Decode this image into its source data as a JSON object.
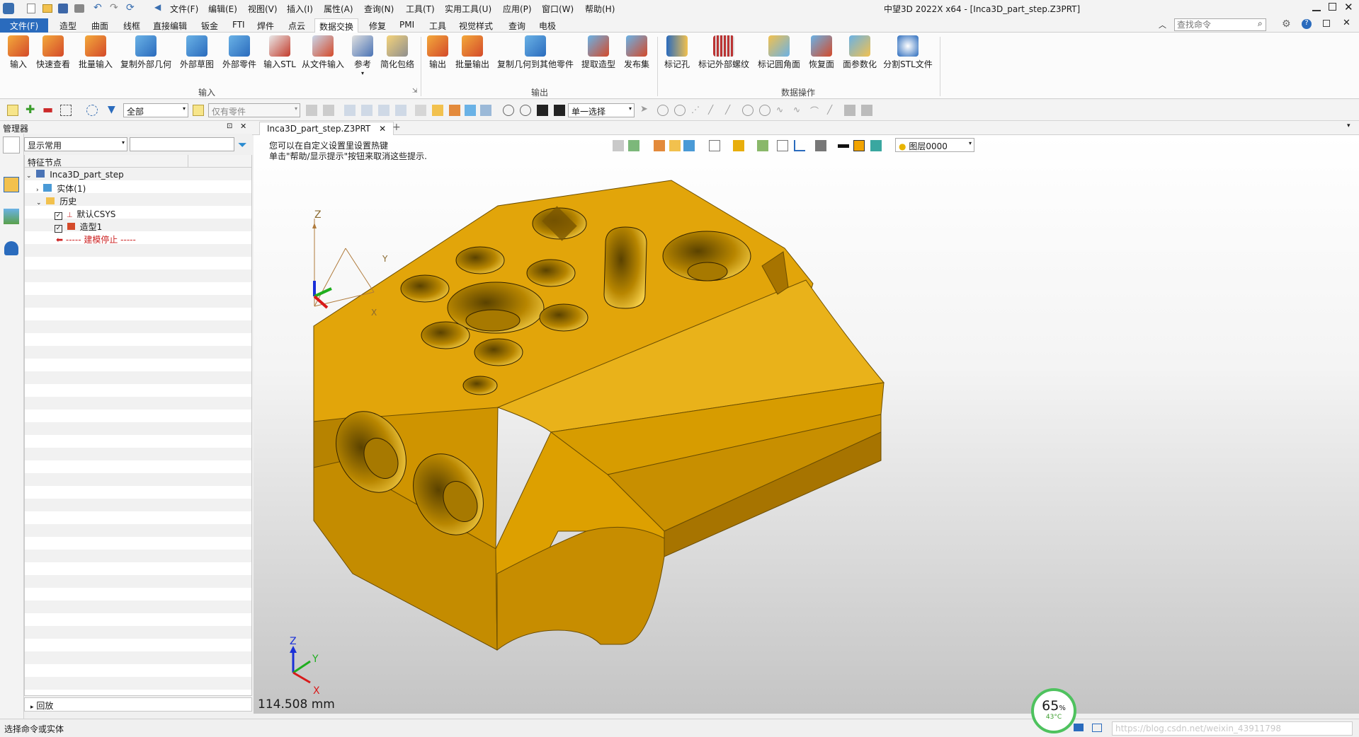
{
  "title_bar": {
    "menus": [
      "文件(F)",
      "编辑(E)",
      "视图(V)",
      "插入(I)",
      "属性(A)",
      "查询(N)",
      "工具(T)",
      "实用工具(U)",
      "应用(P)",
      "窗口(W)",
      "帮助(H)"
    ],
    "window_title": "中望3D 2022X x64 - [Inca3D_part_step.Z3PRT]"
  },
  "ribbon_tabs": [
    "文件(F)",
    "造型",
    "曲面",
    "线框",
    "直接编辑",
    "钣金",
    "FTI",
    "焊件",
    "点云",
    "数据交换",
    "修复",
    "PMI",
    "工具",
    "视觉样式",
    "查询",
    "电极"
  ],
  "active_tab": "数据交换",
  "search": {
    "placeholder": "查找命令"
  },
  "ribbon": {
    "input_buttons": [
      "输入",
      "快速查看",
      "批量输入",
      "复制外部几何",
      "外部草图",
      "外部零件",
      "输入STL",
      "从文件输入",
      "参考",
      "简化包络"
    ],
    "output_buttons": [
      "输出",
      "批量输出",
      "复制几何到其他零件",
      "提取造型",
      "发布集"
    ],
    "dataop_buttons": [
      "标记孔",
      "标记外部螺纹",
      "标记圆角面",
      "恢复面",
      "面参数化",
      "分割STL文件"
    ],
    "groups": {
      "input": "输入",
      "output": "输出",
      "dataop": "数据操作"
    }
  },
  "toolbar2": {
    "filter_all": "全部",
    "filter_parts": "仅有零件",
    "select_mode": "单一选择"
  },
  "manager": {
    "title": "管理器",
    "display": "显示常用",
    "column": "特征节点",
    "tree": {
      "root": "Inca3D_part_step",
      "solid": "实体(1)",
      "history": "历史",
      "csys": "默认CSYS",
      "shape": "造型1",
      "stop": "----- 建模停止 -----"
    },
    "rollback": "回放"
  },
  "viewport": {
    "tab": "Inca3D_part_step.Z3PRT",
    "hint1": "您可以在自定义设置里设置热键",
    "hint2": "单击\"帮助/显示提示\"按钮来取消这些提示.",
    "layer": "图层0000",
    "scale": "114.508 mm",
    "axis_z": "Z",
    "axis_x": "X",
    "axis_y": "Y"
  },
  "status": {
    "text": "选择命令或实体",
    "perf": "65",
    "perf_unit": "%",
    "temp": "43°C",
    "watermark": "https://blog.csdn.net/weixin_43911798"
  },
  "colors": {
    "part": "#e8ae0c",
    "accent": "#2a6bbd"
  }
}
